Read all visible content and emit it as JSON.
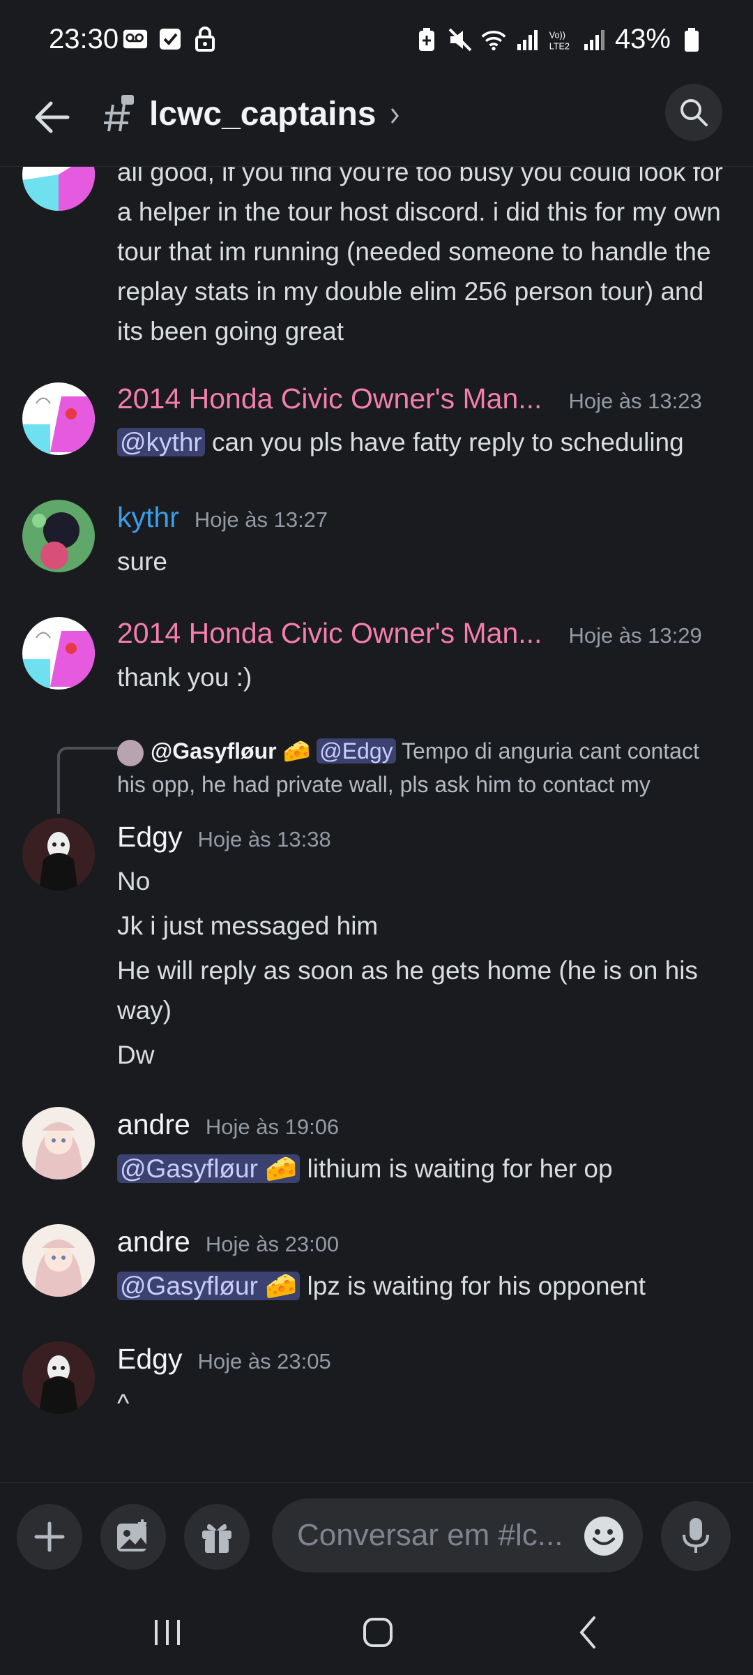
{
  "status_bar": {
    "time": "23:30",
    "battery_percent": "43%",
    "icons_left": [
      "voicemail-icon",
      "check-box-icon",
      "lock-icon"
    ],
    "icons_right": [
      "battery-saver-icon",
      "mute-icon",
      "wifi-icon",
      "signal-icon",
      "volte-lte2-icon",
      "signal-icon",
      "battery-icon"
    ]
  },
  "header": {
    "channel_name": "lcwc_captains",
    "back_icon": "arrow-left-icon",
    "search_icon": "search-icon"
  },
  "messages": {
    "m0": {
      "text": "all good, if you find you're too busy you could look for a helper in the tour host discord. i did this for my own tour that im running (needed someone to handle the replay stats in my double elim 256 person tour) and its been going great"
    },
    "m1": {
      "author": "2014 Honda Civic Owner's Man...",
      "timestamp": "Hoje às 13:23",
      "mention": "@kythr",
      "text": " can you pls have fatty reply to scheduling",
      "author_color": "#f47fae"
    },
    "m2": {
      "author": "kythr",
      "timestamp": "Hoje às 13:27",
      "text": "sure",
      "author_color": "#3b9ee8"
    },
    "m3": {
      "author": "2014 Honda Civic Owner's Man...",
      "timestamp": "Hoje às 13:29",
      "text": "thank you :)",
      "author_color": "#f47fae"
    },
    "m4": {
      "reply": {
        "author": "@Gasyfløur 🧀",
        "mention": "@Edgy",
        "text": " Tempo di anguria cant contact his opp, he had private wall, pls ask him to contact my"
      },
      "author": "Edgy",
      "timestamp": "Hoje às 13:38",
      "lines": [
        "No",
        "Jk i just messaged him",
        "He will reply as soon as he gets home (he is on his way)",
        "Dw"
      ],
      "author_color": "#f2f3f5"
    },
    "m5": {
      "author": "andre",
      "timestamp": "Hoje às 19:06",
      "mention": "@Gasyfløur 🧀",
      "text": "  lithium is waiting for her op",
      "author_color": "#f2f3f5"
    },
    "m6": {
      "author": "andre",
      "timestamp": "Hoje às 23:00",
      "mention": "@Gasyfløur 🧀",
      "text": " lpz is waiting for his opponent",
      "author_color": "#f2f3f5"
    },
    "m7": {
      "author": "Edgy",
      "timestamp": "Hoje às 23:05",
      "text": "^",
      "author_color": "#f2f3f5"
    }
  },
  "composer": {
    "placeholder": "Conversar em #lc...",
    "buttons": [
      "plus-icon",
      "image-icon",
      "gift-icon",
      "emoji-icon",
      "microphone-icon"
    ]
  },
  "navbar": {
    "buttons": [
      "recent-apps-icon",
      "home-icon",
      "back-icon"
    ]
  }
}
